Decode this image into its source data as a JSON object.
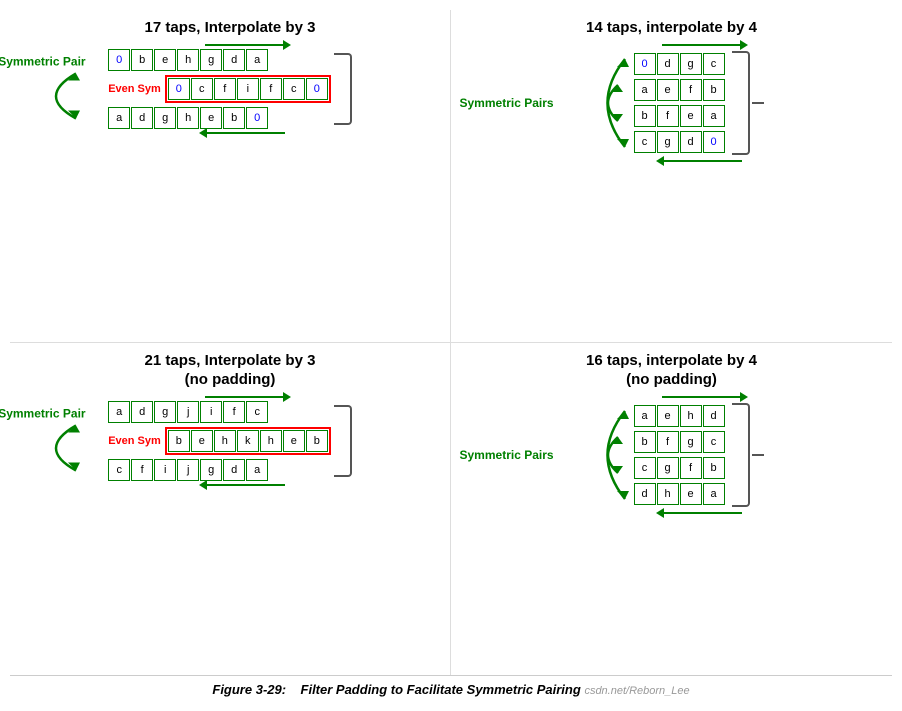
{
  "quadrants": [
    {
      "id": "q1",
      "title": "17 taps, Interpolate by 3",
      "arrow_top_dir": "right",
      "arrow_bot_dir": "left",
      "sym_label": "Symmetric Pair",
      "even_sym_label": "Even Sym",
      "rows": [
        {
          "cells": [
            "0",
            "b",
            "e",
            "h",
            "g",
            "d",
            "a"
          ],
          "style": "normal",
          "cell0_blue": true
        },
        {
          "cells": [
            "0",
            "c",
            "f",
            "i",
            "f",
            "c",
            "0"
          ],
          "style": "even_sym",
          "cell0_blue": true,
          "cell6_blue": true
        },
        {
          "cells": [
            "a",
            "d",
            "g",
            "h",
            "e",
            "b",
            "0"
          ],
          "style": "normal",
          "cell6_blue": true
        }
      ]
    },
    {
      "id": "q2",
      "title": "14 taps, interpolate by 4",
      "arrow_top_dir": "right",
      "arrow_bot_dir": "left",
      "sym_label": "Symmetric Pairs",
      "rows": [
        {
          "cells": [
            "0",
            "d",
            "g",
            "c"
          ],
          "cell0_blue": true
        },
        {
          "cells": [
            "a",
            "e",
            "f",
            "b"
          ]
        },
        {
          "cells": [
            "b",
            "f",
            "e",
            "a"
          ]
        },
        {
          "cells": [
            "c",
            "g",
            "d",
            "0"
          ],
          "cell3_blue": true
        }
      ]
    },
    {
      "id": "q3",
      "title": "21 taps, Interpolate by 3\n(no padding)",
      "arrow_top_dir": "right",
      "arrow_bot_dir": "left",
      "sym_label": "Symmetric Pair",
      "even_sym_label": "Even Sym",
      "rows": [
        {
          "cells": [
            "a",
            "d",
            "g",
            "j",
            "i",
            "f",
            "c"
          ],
          "style": "normal"
        },
        {
          "cells": [
            "b",
            "e",
            "h",
            "k",
            "h",
            "e",
            "b"
          ],
          "style": "even_sym"
        },
        {
          "cells": [
            "c",
            "f",
            "i",
            "j",
            "g",
            "d",
            "a"
          ],
          "style": "normal"
        }
      ]
    },
    {
      "id": "q4",
      "title": "16 taps, interpolate by 4\n(no padding)",
      "arrow_top_dir": "right",
      "arrow_bot_dir": "left",
      "sym_label": "Symmetric Pairs",
      "rows": [
        {
          "cells": [
            "a",
            "e",
            "h",
            "d"
          ]
        },
        {
          "cells": [
            "b",
            "f",
            "g",
            "c"
          ]
        },
        {
          "cells": [
            "c",
            "g",
            "f",
            "b"
          ]
        },
        {
          "cells": [
            "d",
            "h",
            "e",
            "a"
          ]
        }
      ]
    }
  ],
  "figure_caption": "Figure 3-29:",
  "figure_text": "Filter Padding to Facilitate Symmetric Pairing",
  "figure_watermark": "csdn.net/Reborn_Lee"
}
